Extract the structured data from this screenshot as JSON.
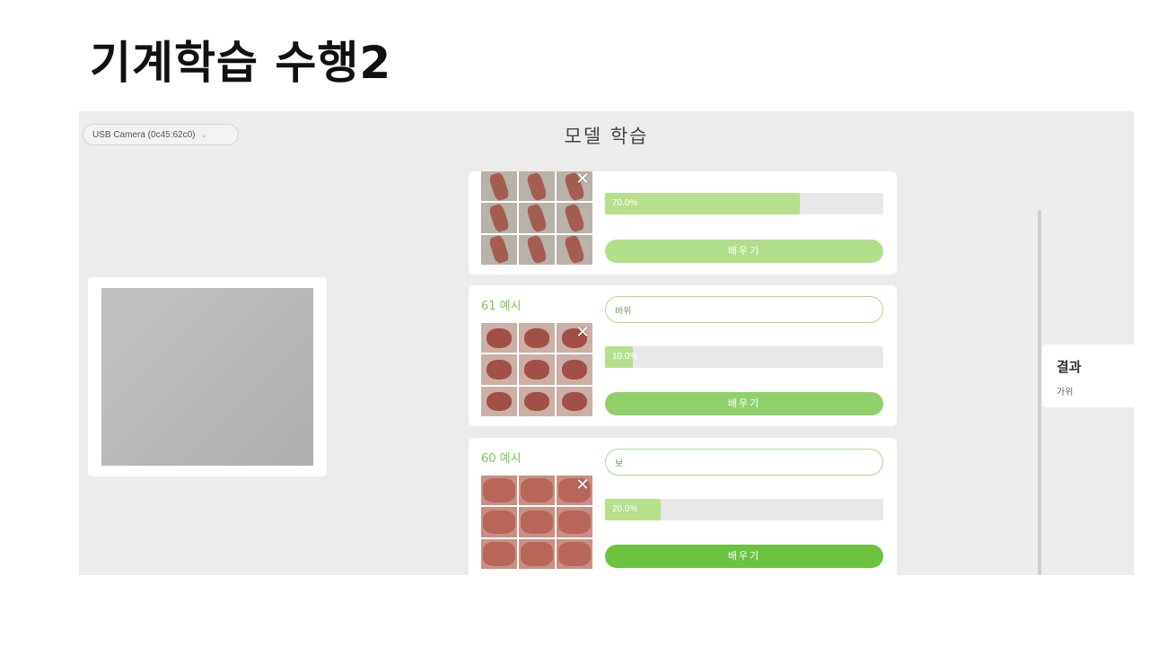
{
  "slide": {
    "title": "기계학습 수행2"
  },
  "app": {
    "title": "모델 학습",
    "camera_select": {
      "value": "USB Camera (0c45:62c0)",
      "icon": "chevron-down-icon"
    }
  },
  "classes": [
    {
      "name": "",
      "label_value": "",
      "progress_percent": 70.0,
      "progress_text": "70.0%",
      "button_label": "배우기",
      "thumb_style": "scissors",
      "button_color": "#b2df8a"
    },
    {
      "name": "61 예시",
      "label_value": "바위",
      "progress_percent": 10.0,
      "progress_text": "10.0%",
      "button_label": "배우기",
      "thumb_style": "rock",
      "button_color": "#8fd06a"
    },
    {
      "name": "60 예시",
      "label_value": "보",
      "progress_percent": 20.0,
      "progress_text": "20.0%",
      "button_label": "배우기",
      "thumb_style": "paper",
      "button_color": "#6cc340"
    }
  ],
  "result": {
    "title": "결과",
    "value": "가위"
  },
  "colors": {
    "accent_green": "#7bc25a",
    "progress_fill": "#b6e08c",
    "background": "#ececec"
  }
}
